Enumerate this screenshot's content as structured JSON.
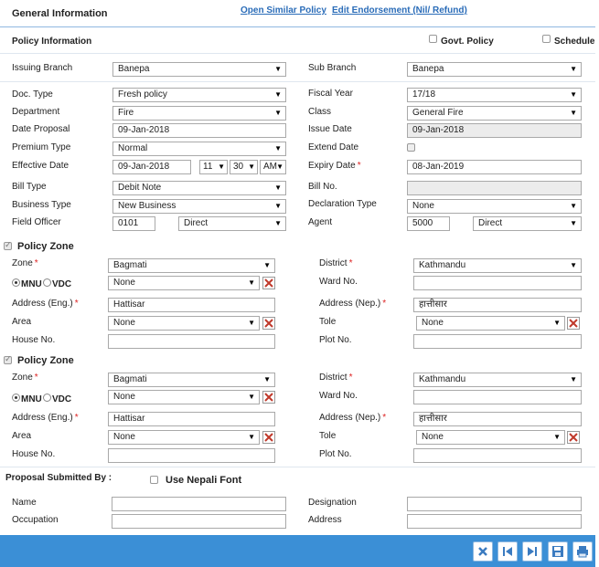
{
  "header": {
    "title": "General Information",
    "link_similar": "Open Similar Policy",
    "link_endorsement": "Edit Endorsement (Nil/ Refund)"
  },
  "policy_info": {
    "title": "Policy Information",
    "govt_policy_label": "Govt. Policy",
    "schedule_label": "Schedule"
  },
  "fields": {
    "issuing_branch": {
      "label": "Issuing Branch",
      "value": "Banepa"
    },
    "sub_branch": {
      "label": "Sub Branch",
      "value": "Banepa"
    },
    "doc_type": {
      "label": "Doc. Type",
      "value": "Fresh policy"
    },
    "fiscal_year": {
      "label": "Fiscal Year",
      "value": "17/18"
    },
    "department": {
      "label": "Department",
      "value": "Fire"
    },
    "class": {
      "label": "Class",
      "value": "General Fire"
    },
    "date_proposal": {
      "label": "Date Proposal",
      "value": "09-Jan-2018"
    },
    "issue_date": {
      "label": "Issue Date",
      "value": "09-Jan-2018"
    },
    "premium_type": {
      "label": "Premium Type",
      "value": "Normal"
    },
    "extend_date": {
      "label": "Extend Date"
    },
    "effective_date": {
      "label": "Effective Date",
      "value": "09-Jan-2018",
      "hour": "11",
      "minute": "30",
      "ampm": "AM"
    },
    "expiry_date": {
      "label": "Expiry Date",
      "req": "*",
      "value": "08-Jan-2019"
    },
    "bill_type": {
      "label": "Bill Type",
      "value": "Debit Note"
    },
    "bill_no": {
      "label": "Bill No.",
      "value": ""
    },
    "business_type": {
      "label": "Business Type",
      "value": "New Business"
    },
    "declaration_type": {
      "label": "Declaration Type",
      "value": "None"
    },
    "field_officer": {
      "label": "Field Officer",
      "code": "0101",
      "mode": "Direct"
    },
    "agent": {
      "label": "Agent",
      "code": "5000",
      "mode": "Direct"
    }
  },
  "zones": [
    {
      "title": "Policy Zone",
      "zone_label": "Zone",
      "zone_value": "Bagmati",
      "district_label": "District",
      "district_value": "Kathmandu",
      "mnu_label": "MNU",
      "vdc_label": "VDC",
      "mnu_value": "None",
      "ward_label": "Ward No.",
      "ward_value": "",
      "addr_eng_label": "Address (Eng.)",
      "addr_eng_value": "Hattisar",
      "addr_nep_label": "Address (Nep.)",
      "addr_nep_value": "हात्तीसार",
      "area_label": "Area",
      "area_value": "None",
      "tole_label": "Tole",
      "tole_value": "None",
      "house_label": "House No.",
      "house_value": "",
      "plot_label": "Plot No.",
      "plot_value": ""
    },
    {
      "title": "Policy Zone",
      "zone_label": "Zone",
      "zone_value": "Bagmati",
      "district_label": "District",
      "district_value": "Kathmandu",
      "mnu_label": "MNU",
      "vdc_label": "VDC",
      "mnu_value": "None",
      "ward_label": "Ward No.",
      "ward_value": "",
      "addr_eng_label": "Address (Eng.)",
      "addr_eng_value": "Hattisar",
      "addr_nep_label": "Address (Nep.)",
      "addr_nep_value": "हात्तीसार",
      "area_label": "Area",
      "area_value": "None",
      "tole_label": "Tole",
      "tole_value": "None",
      "house_label": "House No.",
      "house_value": "",
      "plot_label": "Plot No.",
      "plot_value": ""
    }
  ],
  "proposal": {
    "title": "Proposal Submitted By :",
    "nepali_font_label": "Use Nepali Font",
    "name_label": "Name",
    "designation_label": "Designation",
    "occupation_label": "Occupation",
    "address_label": "Address"
  },
  "footer": {
    "buttons": [
      "close-icon",
      "first-icon",
      "last-icon",
      "save-icon",
      "print-icon"
    ]
  },
  "colors": {
    "accent": "#3b8fd6",
    "link": "#2a6cb8",
    "required": "#dd2222"
  }
}
